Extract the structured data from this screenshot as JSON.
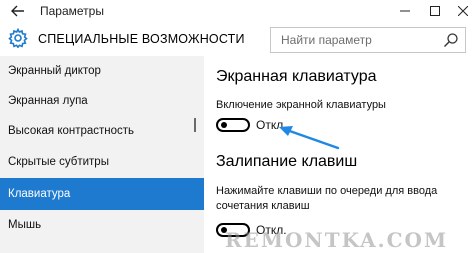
{
  "window": {
    "title": "Параметры",
    "back_icon": "back-arrow-icon",
    "controls": [
      "minimize-icon",
      "maximize-icon",
      "close-icon"
    ]
  },
  "header": {
    "icon": "gear-icon",
    "title": "СПЕЦИАЛЬНЫЕ ВОЗМОЖНОСТИ",
    "search_placeholder": "Найти параметр",
    "search_icon": "search-icon"
  },
  "sidebar": {
    "items": [
      {
        "label": "Экранный диктор"
      },
      {
        "label": "Экранная лупа"
      },
      {
        "label": "Высокая контрастность"
      },
      {
        "label": "Скрытые субтитры"
      },
      {
        "label": "Клавиатура",
        "selected": true
      },
      {
        "label": "Мышь"
      }
    ],
    "accent_color": "#1e7ace"
  },
  "main": {
    "keyboard": {
      "heading": "Экранная клавиатура",
      "setting_label": "Включение экранной клавиатуры",
      "toggle_state": "Откл.",
      "toggle_on": false
    },
    "sticky": {
      "heading": "Залипание клавиш",
      "setting_label_line1": "Нажимайте клавиши по очереди для ввода",
      "setting_label_line2": "сочетания клавиш",
      "toggle_state": "Откл.",
      "toggle_on": false
    },
    "annotation_color": "#1e88e5"
  },
  "watermark": "REMONTKA.COM"
}
